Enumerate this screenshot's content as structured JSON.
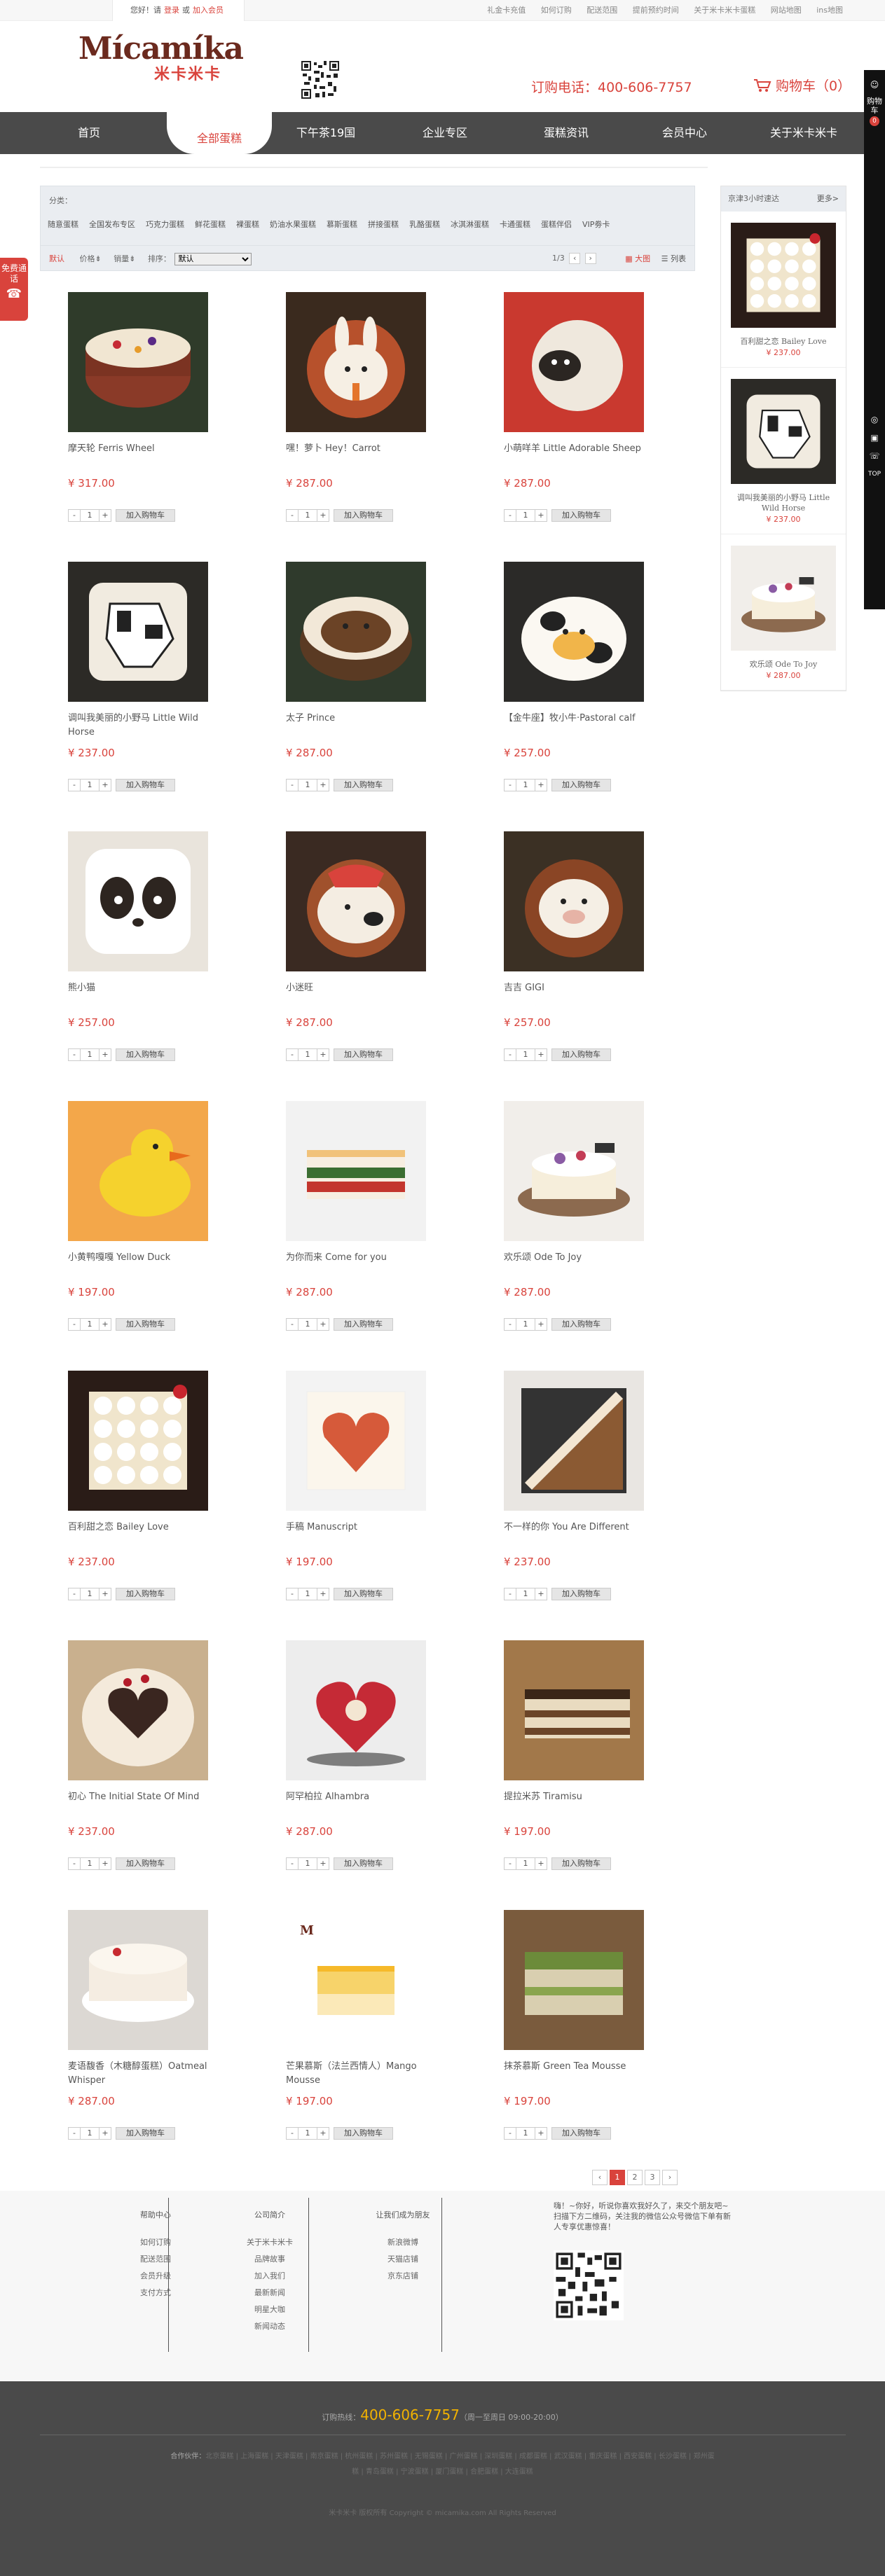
{
  "topbar": {
    "greeting": "您好！请",
    "login": "登录",
    "or": "或",
    "register": "加入会员",
    "links": [
      "礼金卡充值",
      "如何订购",
      "配送范围",
      "提前预约时间",
      "关于米卡米卡蛋糕",
      "网站地图",
      "ins地图"
    ]
  },
  "header": {
    "logo_en": "Mícamíka",
    "logo_cn": "米卡米卡",
    "hotline": "订购电话：400-606-7757",
    "cart": "购物车（0）"
  },
  "nav": [
    "首页",
    "全部蛋糕",
    "下午茶19国",
    "企业专区",
    "蛋糕资讯",
    "会员中心",
    "关于米卡米卡"
  ],
  "nav_active_index": 1,
  "filter": {
    "category_label": "分类：",
    "categories": [
      "随意蛋糕",
      "全国发布专区",
      "巧克力蛋糕",
      "鲜花蛋糕",
      "裸蛋糕",
      "奶油水果蛋糕",
      "慕斯蛋糕",
      "拼接蛋糕",
      "乳酪蛋糕",
      "冰淇淋蛋糕",
      "卡通蛋糕",
      "蛋糕伴侣",
      "VIP劵卡"
    ],
    "sort_default": "默认",
    "sort_price": "价格⇟",
    "sort_sales": "销量⇟",
    "sort_label": "排序：",
    "sort_selected": "默认",
    "page_info": "1/3",
    "prev": "‹",
    "next": "›",
    "view_big": "大图",
    "view_list": "列表"
  },
  "products": [
    {
      "name": "摩天轮 Ferris Wheel",
      "price": "¥ 317.00",
      "img": "naked"
    },
    {
      "name": "嘿！萝卜 Hey！Carrot",
      "price": "¥ 287.00",
      "img": "rabbit"
    },
    {
      "name": "小萌咩羊 Little Adorable Sheep",
      "price": "¥ 287.00",
      "img": "sheep"
    },
    {
      "name": "调叫我美丽的小野马 Little Wild Horse",
      "price": "¥ 237.00",
      "img": "horse"
    },
    {
      "name": "太子 Prince",
      "price": "¥ 287.00",
      "img": "monkey"
    },
    {
      "name": "【金牛座】牧小牛·Pastoral calf",
      "price": "¥ 257.00",
      "img": "cow"
    },
    {
      "name": "熊小猫",
      "price": "¥ 257.00",
      "img": "panda"
    },
    {
      "name": "小迷旺",
      "price": "¥ 287.00",
      "img": "dog"
    },
    {
      "name": "吉吉 GIGI",
      "price": "¥ 257.00",
      "img": "pig"
    },
    {
      "name": "小黄鸭嘎嘎 Yellow Duck",
      "price": "¥ 197.00",
      "img": "duck"
    },
    {
      "name": "为你而来 Come for you",
      "price": "¥ 287.00",
      "img": "layer"
    },
    {
      "name": "欢乐颂 Ode To Joy",
      "price": "¥ 287.00",
      "img": "joy"
    },
    {
      "name": "百利甜之恋 Bailey Love",
      "price": "¥ 237.00",
      "img": "bailey"
    },
    {
      "name": "手稿 Manuscript",
      "price": "¥ 197.00",
      "img": "heart"
    },
    {
      "name": "不一样的你 You Are Different",
      "price": "¥ 237.00",
      "img": "stripe"
    },
    {
      "name": "初心 The Initial State Of Mind",
      "price": "¥ 237.00",
      "img": "initial"
    },
    {
      "name": "阿罕柏拉 Alhambra",
      "price": "¥ 287.00",
      "img": "alhambra"
    },
    {
      "name": "提拉米苏 Tiramisu",
      "price": "¥ 197.00",
      "img": "tiramisu"
    },
    {
      "name": "麦语馥香（木糖醇蛋糕）Oatmeal Whisper",
      "price": "¥ 287.00",
      "img": "oat"
    },
    {
      "name": "芒果慕斯（法兰西情人）Mango Mousse",
      "price": "¥ 197.00",
      "img": "mango"
    },
    {
      "name": "抹茶慕斯 Green Tea Mousse",
      "price": "¥ 197.00",
      "img": "matcha"
    }
  ],
  "qty_default": "1",
  "minus": "-",
  "plus": "+",
  "add_cart": "加入购物车",
  "pager": [
    "‹",
    "1",
    "2",
    "3",
    "›"
  ],
  "sidebar": {
    "title": "京津3小时速达",
    "more": "更多>",
    "items": [
      {
        "name": "百利甜之恋 Bailey Love",
        "price": "¥ 237.00",
        "img": "bailey"
      },
      {
        "name": "调叫我美丽的小野马 Little Wild Horse",
        "price": "¥ 237.00",
        "img": "horse"
      },
      {
        "name": "欢乐颂 Ode To Joy",
        "price": "¥ 287.00",
        "img": "joy"
      }
    ]
  },
  "rail": {
    "cart": "购物车",
    "count": "0",
    "top": "TOP"
  },
  "free_badge": "免费通话",
  "footer": {
    "cols": [
      {
        "title": "帮助中心",
        "links": [
          "如何订购",
          "配送范围",
          "会员升级",
          "支付方式"
        ]
      },
      {
        "title": "公司简介",
        "links": [
          "关于米卡米卡",
          "品牌故事",
          "加入我们",
          "最新新闻",
          "明星大咖",
          "新闻动态"
        ]
      },
      {
        "title": "让我们成为朋友",
        "links": [
          "新浪微博",
          "天猫店铺",
          "京东店铺"
        ]
      }
    ],
    "wx_text": "嗨！~你好，听说你喜欢我好久了，来交个朋友吧~扫描下方二维码，关注我的微信公众号微信下单有新人专享优惠惊喜！",
    "tel_label": "订购热线：",
    "tel": "400-606-7757",
    "tel_hours": "（周一至周日 09:00-20:00）",
    "partners_label": "合作伙伴：",
    "partners": "北京蛋糕 | 上海蛋糕 | 天津蛋糕 | 南京蛋糕 | 杭州蛋糕 | 苏州蛋糕 | 无锡蛋糕 | 广州蛋糕 | 深圳蛋糕 | 成都蛋糕 | 武汉蛋糕 | 重庆蛋糕 | 西安蛋糕 | 长沙蛋糕 | 郑州蛋糕 | 青岛蛋糕 | 宁波蛋糕 | 厦门蛋糕 | 合肥蛋糕 | 大连蛋糕",
    "copyright": "米卡米卡 版权所有 Copyright © micamika.com All Rights Reserved"
  },
  "colors": {
    "accent": "#d9433c",
    "nav": "#4a4a4a",
    "footer": "#4a4a4a",
    "gold": "#f2b200"
  }
}
